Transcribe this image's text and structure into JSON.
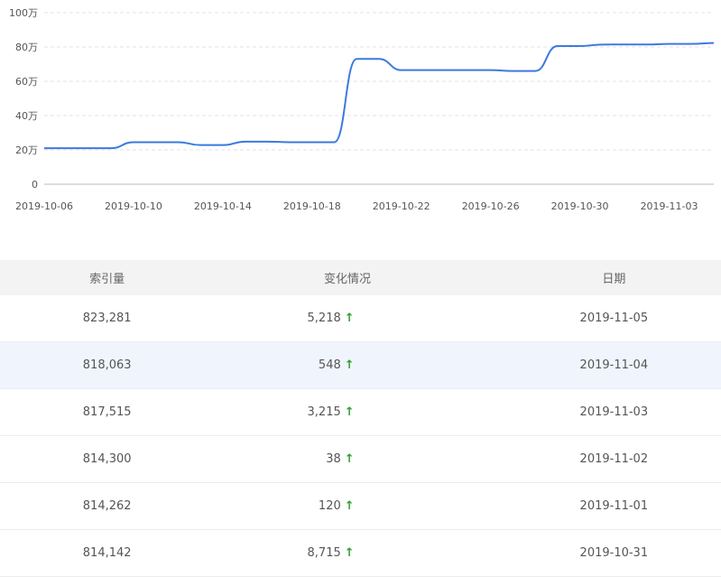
{
  "chart_data": {
    "type": "line",
    "x_ticks": [
      "2019-10-06",
      "2019-10-10",
      "2019-10-14",
      "2019-10-18",
      "2019-10-22",
      "2019-10-26",
      "2019-10-30",
      "2019-11-03"
    ],
    "y_ticks": [
      "0",
      "20万",
      "40万",
      "60万",
      "80万",
      "100万"
    ],
    "ylim": [
      0,
      1000000
    ],
    "grid": true,
    "line_color": "#3b7ae0",
    "x": [
      "2019-10-06",
      "2019-10-07",
      "2019-10-08",
      "2019-10-09",
      "2019-10-10",
      "2019-10-11",
      "2019-10-12",
      "2019-10-13",
      "2019-10-14",
      "2019-10-15",
      "2019-10-16",
      "2019-10-17",
      "2019-10-18",
      "2019-10-19",
      "2019-10-20",
      "2019-10-21",
      "2019-10-22",
      "2019-10-23",
      "2019-10-24",
      "2019-10-25",
      "2019-10-26",
      "2019-10-27",
      "2019-10-28",
      "2019-10-29",
      "2019-10-30",
      "2019-10-31",
      "2019-11-01",
      "2019-11-02",
      "2019-11-03",
      "2019-11-04",
      "2019-11-05"
    ],
    "values": [
      210000,
      210000,
      210000,
      210000,
      245000,
      245000,
      245000,
      228000,
      228000,
      248000,
      248000,
      245000,
      245000,
      245000,
      730000,
      730000,
      665000,
      665000,
      665000,
      665000,
      665000,
      660000,
      660000,
      805000,
      805000,
      814142,
      814262,
      814300,
      817515,
      818063,
      823281
    ]
  },
  "table": {
    "headers": [
      "索引量",
      "变化情况",
      "日期"
    ],
    "rows": [
      {
        "count": "823,281",
        "change": "5,218",
        "arrow": "↑",
        "date": "2019-11-05"
      },
      {
        "count": "818,063",
        "change": "548",
        "arrow": "↑",
        "date": "2019-11-04"
      },
      {
        "count": "817,515",
        "change": "3,215",
        "arrow": "↑",
        "date": "2019-11-03"
      },
      {
        "count": "814,300",
        "change": "38",
        "arrow": "↑",
        "date": "2019-11-02"
      },
      {
        "count": "814,262",
        "change": "120",
        "arrow": "↑",
        "date": "2019-11-01"
      },
      {
        "count": "814,142",
        "change": "8,715",
        "arrow": "↑",
        "date": "2019-10-31"
      }
    ]
  }
}
